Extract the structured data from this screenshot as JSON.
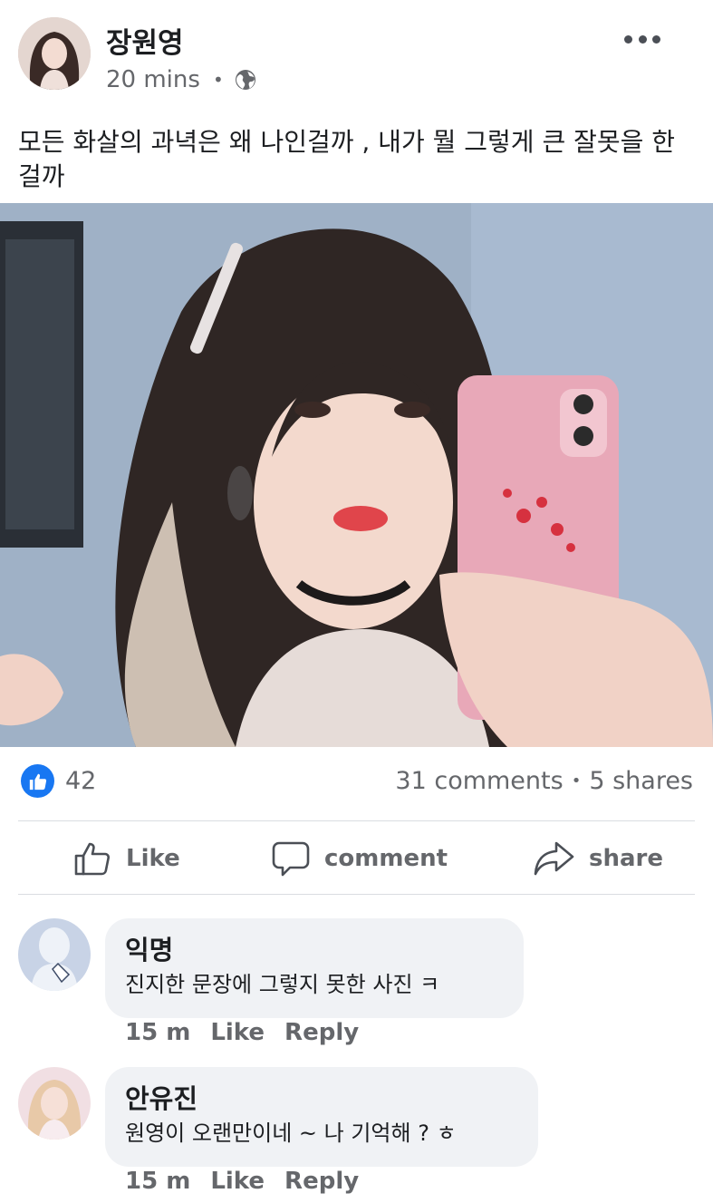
{
  "post": {
    "author": "장원영",
    "time": "20 mins",
    "separator": "•",
    "privacy_icon": "globe-icon",
    "more_icon": "more-options-icon",
    "text": "모든 화살의 과녁은 왜 나인걸까 , 내가 뭘 그렇게 큰 잘못을 한걸까"
  },
  "stats": {
    "reaction_icon": "like-reaction-icon",
    "likes": "42",
    "comments": "31 comments",
    "separator": "•",
    "shares": "5 shares"
  },
  "actions": {
    "like": "Like",
    "comment": "comment",
    "share": "share"
  },
  "comments": [
    {
      "name": "익명",
      "text": "진지한 문장에 그렇지 못한 사진 ㅋ",
      "time": "15 m",
      "like": "Like",
      "reply": "Reply"
    },
    {
      "name": "안유진",
      "text": "원영이 오랜만이네 ~ 나 기억해 ? ㅎ",
      "time": "15 m",
      "like": "Like",
      "reply": "Reply"
    }
  ],
  "colors": {
    "brand_blue": "#1877f2",
    "secondary_text": "#65676b",
    "bubble_bg": "#f0f2f5"
  }
}
